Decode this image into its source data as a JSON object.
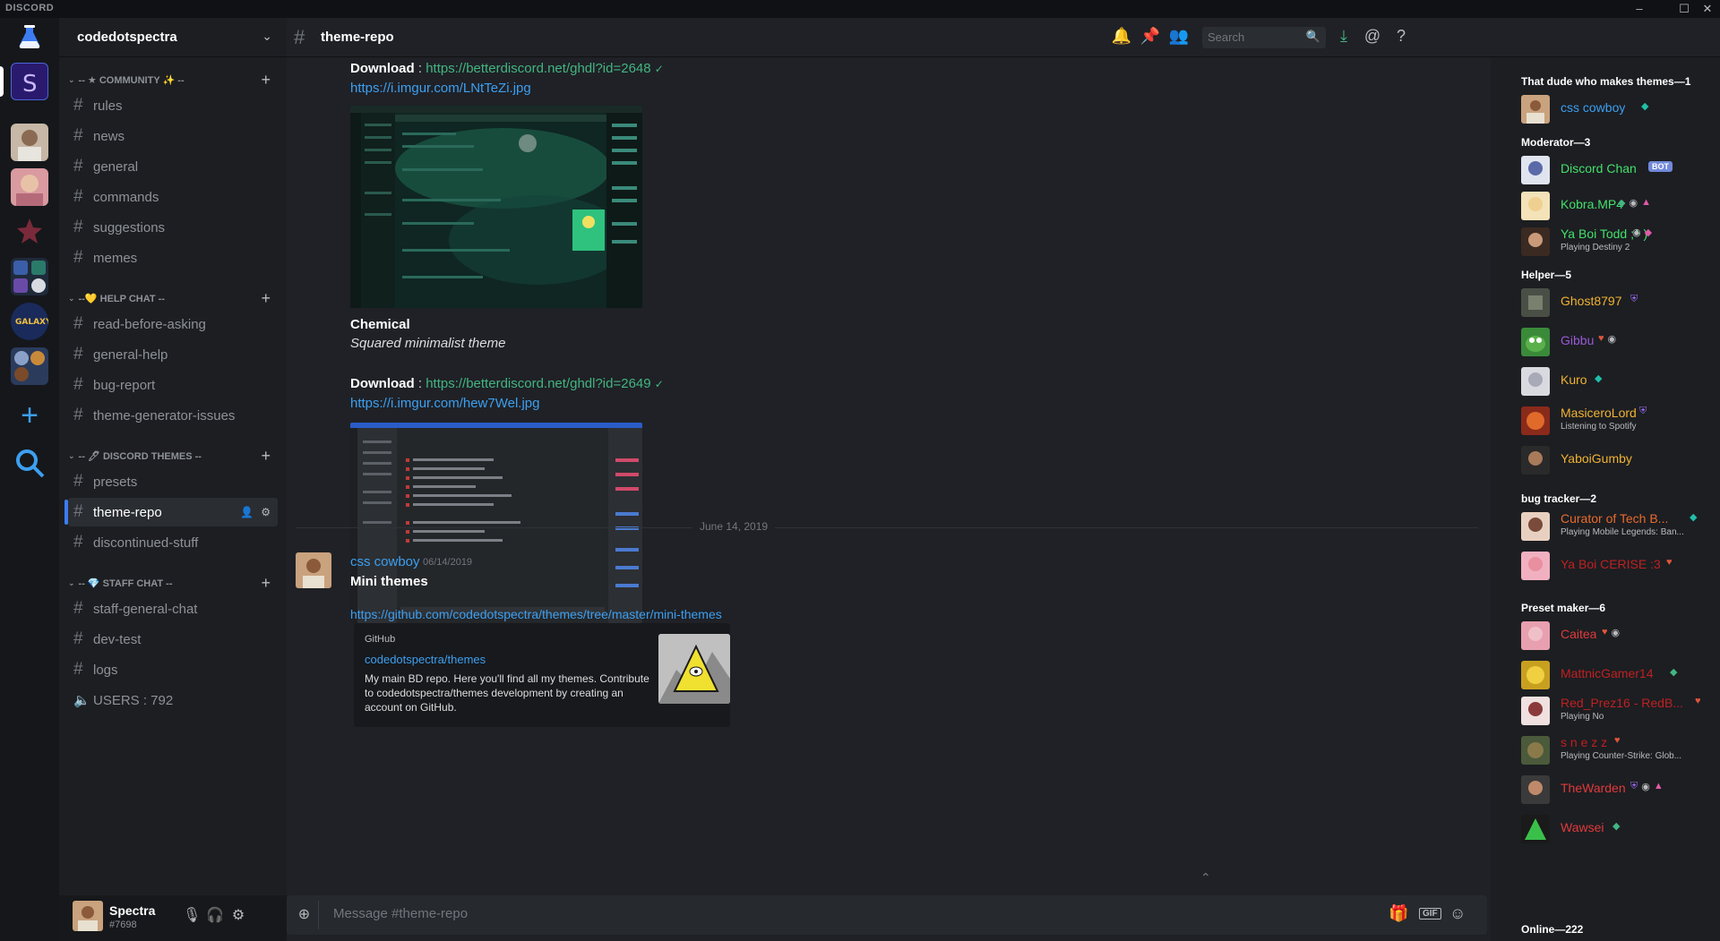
{
  "app": {
    "brand": "DISCORD"
  },
  "server": {
    "name": "codedotspectra"
  },
  "categories": [
    {
      "label": "-- ★ COMMUNITY ✨ --"
    },
    {
      "label": "--💛 HELP CHAT --"
    },
    {
      "label": "-- 🖊 DISCORD THEMES --"
    },
    {
      "label": "-- 💎 STAFF CHAT --"
    }
  ],
  "channels": {
    "rules": "rules",
    "news": "news",
    "general": "general",
    "commands": "commands",
    "suggestions": "suggestions",
    "memes": "memes",
    "read_before_asking": "read-before-asking",
    "general_help": "general-help",
    "bug_report": "bug-report",
    "theme_generator_issues": "theme-generator-issues",
    "presets": "presets",
    "theme_repo": "theme-repo",
    "discontinued_stuff": "discontinued-stuff",
    "staff_general_chat": "staff-general-chat",
    "dev_test": "dev-test",
    "logs": "logs",
    "users": "USERS : 792"
  },
  "user": {
    "name": "Spectra",
    "tag": "#7698"
  },
  "topbar": {
    "channel": "theme-repo",
    "search_placeholder": "Search"
  },
  "messages": {
    "download_label": "Download",
    "download_sep": " : ",
    "link1": "https://betterdiscord.net/ghdl?id=2648",
    "img1": "https://i.imgur.com/LNtTeZi.jpg",
    "theme2_title": "Chemical",
    "theme2_desc": "Squared minimalist theme",
    "link2": "https://betterdiscord.net/ghdl?id=2649",
    "img2": "https://i.imgur.com/hew7Wel.jpg",
    "date_divider": "June 14, 2019",
    "author": "css cowboy",
    "timestamp": "06/14/2019",
    "post_title": "Mini themes",
    "post_link": "https://github.com/codedotspectra/themes/tree/master/mini-themes",
    "embed_provider": "GitHub",
    "embed_title": "codedotspectra/themes",
    "embed_desc": "My main BD repo. Here you'll find all my themes. Contribute to codedotspectra/themes development by creating an account on GitHub."
  },
  "composer": {
    "placeholder": "Message #theme-repo"
  },
  "members": {
    "groups": [
      {
        "role": "That dude who makes themes—1"
      },
      {
        "role": "Moderator—3"
      },
      {
        "role": "Helper—5"
      },
      {
        "role": "bug tracker—2"
      },
      {
        "role": "Preset maker—6"
      },
      {
        "role": "Online—222"
      }
    ],
    "list": [
      {
        "name": "css cowboy",
        "color": "#3d9ff0"
      },
      {
        "name": "Discord Chan",
        "color": "#43e06a",
        "badge": "BOT"
      },
      {
        "name": "Kobra.MP4",
        "color": "#43e06a"
      },
      {
        "name": "Ya Boi Todd ;^ )",
        "color": "#43e06a",
        "status": "Playing Destiny 2"
      },
      {
        "name": "Ghost8797",
        "color": "#f0b232"
      },
      {
        "name": "Gibbu",
        "color": "#9b59d6"
      },
      {
        "name": "Kuro",
        "color": "#f0b232"
      },
      {
        "name": "MasiceroLord",
        "color": "#f0b232",
        "status": "Listening to Spotify"
      },
      {
        "name": "YaboiGumby",
        "color": "#f0b232"
      },
      {
        "name": "Curator of Tech B...",
        "color": "#e96a2d",
        "status": "Playing Mobile Legends: Ban..."
      },
      {
        "name": "Ya Boi CERISE :3",
        "color": "#c02020"
      },
      {
        "name": "Caitea",
        "color": "#e03a3a"
      },
      {
        "name": "MattnicGamer14",
        "color": "#c02020"
      },
      {
        "name": "Red_Prez16 - RedB...",
        "color": "#c02020",
        "status": "Playing No"
      },
      {
        "name": "s n e z z",
        "color": "#c02020",
        "status": "Playing Counter-Strike: Glob..."
      },
      {
        "name": "TheWarden",
        "color": "#e03a3a"
      },
      {
        "name": "Wawsei",
        "color": "#e03a3a"
      }
    ]
  },
  "colors": {
    "accent": "#3d7cf0",
    "link": "#3d9ff0",
    "green": "#43b581",
    "bg": "#1f2126"
  }
}
